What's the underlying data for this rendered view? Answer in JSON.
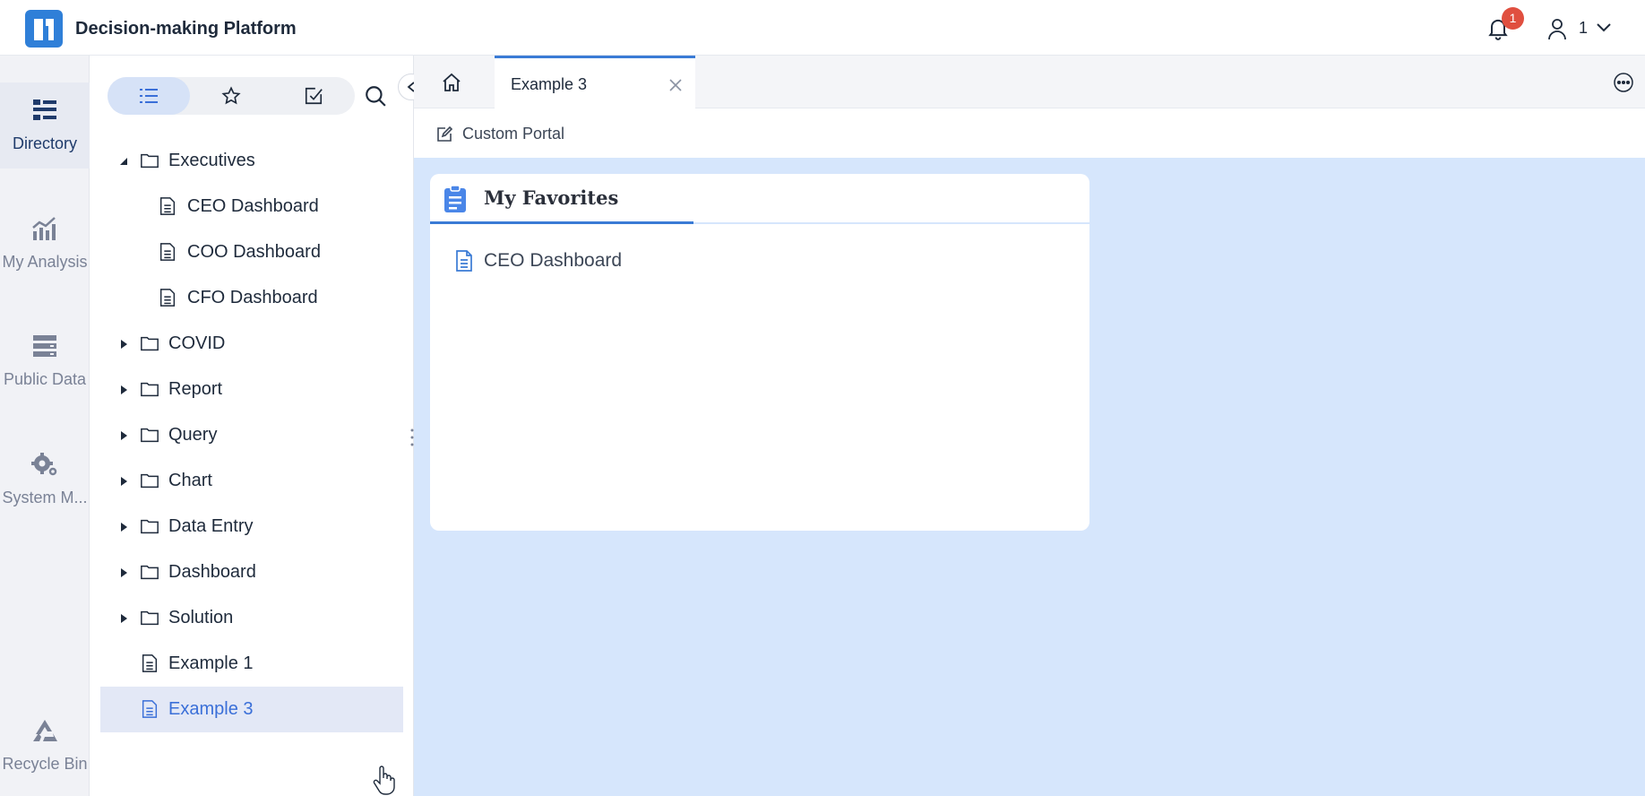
{
  "app": {
    "title": "Decision-making Platform"
  },
  "header": {
    "notification_count": "1",
    "user_name": "1"
  },
  "rail": {
    "items": [
      {
        "label": "Directory",
        "icon": "directory-icon",
        "active": true
      },
      {
        "label": "My Analysis",
        "icon": "analysis-icon",
        "active": false
      },
      {
        "label": "Public Data",
        "icon": "database-icon",
        "active": false
      },
      {
        "label": "System M...",
        "icon": "gear-icon",
        "active": false
      },
      {
        "label": "Recycle Bin",
        "icon": "recycle-icon",
        "active": false
      }
    ]
  },
  "panel": {
    "tabs": [
      {
        "icon": "list-icon",
        "active": true
      },
      {
        "icon": "star-icon",
        "active": false
      },
      {
        "icon": "checked-box-icon",
        "active": false
      }
    ],
    "tree": [
      {
        "label": "Executives",
        "type": "folder",
        "expanded": true,
        "level": 0
      },
      {
        "label": "CEO Dashboard",
        "type": "file",
        "level": 1
      },
      {
        "label": "COO Dashboard",
        "type": "file",
        "level": 1
      },
      {
        "label": "CFO Dashboard",
        "type": "file",
        "level": 1
      },
      {
        "label": "COVID",
        "type": "folder",
        "expanded": false,
        "level": 0
      },
      {
        "label": "Report",
        "type": "folder",
        "expanded": false,
        "level": 0
      },
      {
        "label": "Query",
        "type": "folder",
        "expanded": false,
        "level": 0
      },
      {
        "label": "Chart",
        "type": "folder",
        "expanded": false,
        "level": 0
      },
      {
        "label": "Data Entry",
        "type": "folder",
        "expanded": false,
        "level": 0
      },
      {
        "label": "Dashboard",
        "type": "folder",
        "expanded": false,
        "level": 0
      },
      {
        "label": "Solution",
        "type": "folder",
        "expanded": false,
        "level": 0
      },
      {
        "label": "Example 1",
        "type": "file",
        "level": 0
      },
      {
        "label": "Example 3",
        "type": "file",
        "level": 0,
        "selected": true
      }
    ]
  },
  "main": {
    "tabs": [
      {
        "label": "Example 3"
      }
    ],
    "toolbar": {
      "custom_portal_label": "Custom Portal"
    },
    "widget": {
      "title": "My Favorites",
      "items": [
        {
          "label": "CEO Dashboard"
        }
      ]
    }
  },
  "colors": {
    "accent": "#3a7bd5",
    "canvas": "#d6e6fc",
    "badge": "#e04f3f",
    "selected_row": "#e3e8f6"
  }
}
